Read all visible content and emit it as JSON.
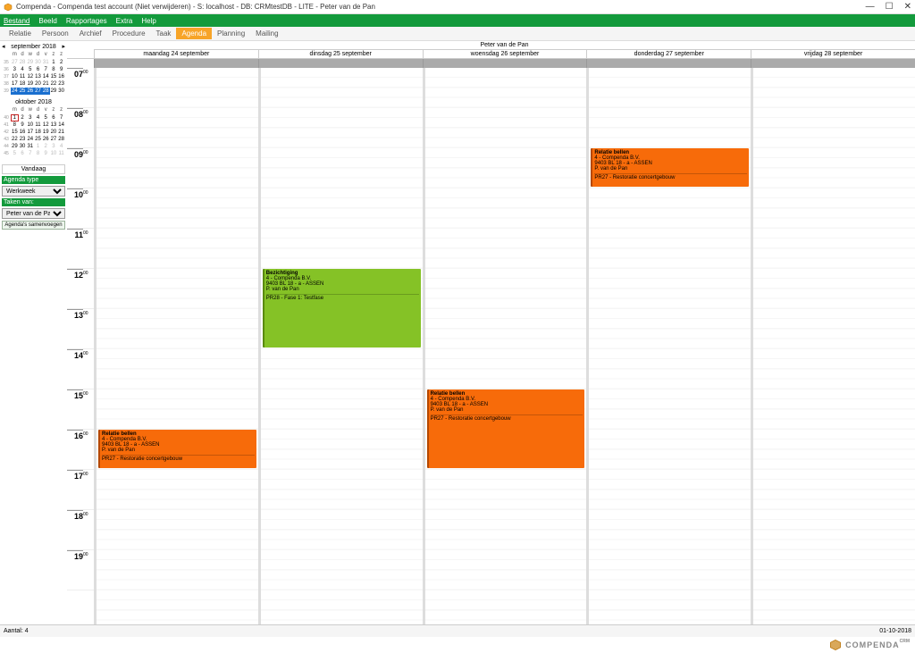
{
  "window": {
    "title": "Compenda - Compenda test account (Niet verwijderen) - S: localhost - DB: CRMtestDB - LITE - Peter van de Pan"
  },
  "menu": {
    "items": [
      "Bestand",
      "Beeld",
      "Rapportages",
      "Extra",
      "Help"
    ]
  },
  "tabs": {
    "items": [
      "Relatie",
      "Persoon",
      "Archief",
      "Procedure",
      "Taak",
      "Agenda",
      "Planning",
      "Mailing"
    ],
    "active": 5
  },
  "sidebar": {
    "month1": {
      "label": "september 2018",
      "dayheads": [
        "m",
        "d",
        "w",
        "d",
        "v",
        "z",
        "z"
      ],
      "rows": [
        {
          "wk": "35",
          "days": [
            "27",
            "28",
            "29",
            "30",
            "31",
            "1",
            "2"
          ],
          "dim": [
            0,
            1,
            2,
            3,
            4
          ]
        },
        {
          "wk": "36",
          "days": [
            "3",
            "4",
            "5",
            "6",
            "7",
            "8",
            "9"
          ],
          "dim": []
        },
        {
          "wk": "37",
          "days": [
            "10",
            "11",
            "12",
            "13",
            "14",
            "15",
            "16"
          ],
          "dim": []
        },
        {
          "wk": "38",
          "days": [
            "17",
            "18",
            "19",
            "20",
            "21",
            "22",
            "23"
          ],
          "dim": []
        },
        {
          "wk": "39",
          "days": [
            "24",
            "25",
            "26",
            "27",
            "28",
            "29",
            "30"
          ],
          "dim": [],
          "hl": [
            0,
            1,
            2,
            3,
            4
          ]
        }
      ]
    },
    "month2": {
      "label": "oktober 2018",
      "dayheads": [
        "m",
        "d",
        "w",
        "d",
        "v",
        "z",
        "z"
      ],
      "rows": [
        {
          "wk": "40",
          "days": [
            "1",
            "2",
            "3",
            "4",
            "5",
            "6",
            "7"
          ],
          "dim": [],
          "today": 0
        },
        {
          "wk": "41",
          "days": [
            "8",
            "9",
            "10",
            "11",
            "12",
            "13",
            "14"
          ],
          "dim": []
        },
        {
          "wk": "42",
          "days": [
            "15",
            "16",
            "17",
            "18",
            "19",
            "20",
            "21"
          ],
          "dim": []
        },
        {
          "wk": "43",
          "days": [
            "22",
            "23",
            "24",
            "25",
            "26",
            "27",
            "28"
          ],
          "dim": []
        },
        {
          "wk": "44",
          "days": [
            "29",
            "30",
            "31",
            "1",
            "2",
            "3",
            "4"
          ],
          "dim": [
            3,
            4,
            5,
            6
          ]
        },
        {
          "wk": "45",
          "days": [
            "5",
            "6",
            "7",
            "8",
            "9",
            "10",
            "11"
          ],
          "dim": [
            0,
            1,
            2,
            3,
            4,
            5,
            6
          ]
        }
      ]
    },
    "today_btn": "Vandaag",
    "agendatype_lbl": "Agenda type",
    "agendatype_val": "Werkweek",
    "taken_lbl": "Taken van:",
    "taken_val": "Peter van de Pan",
    "merge_btn": "Agenda's samenvoegen"
  },
  "agenda": {
    "person": "Peter van de Pan",
    "days": [
      "maandag 24 september",
      "dinsdag 25 september",
      "woensdag 26 september",
      "donderdag 27 september",
      "vrijdag 28 september"
    ],
    "hours": [
      "07",
      "08",
      "09",
      "10",
      "11",
      "12",
      "13",
      "14",
      "15",
      "16",
      "17",
      "18",
      "19"
    ],
    "minute_label": "00",
    "events": [
      {
        "day": 0,
        "start": 16,
        "dur": 1,
        "color": "orange",
        "title": "Relatie bellen",
        "l1": "4 - Compenda B.V.",
        "l2": "9403 BL 18 - a -  ASSEN",
        "l3": "P. van de Pan",
        "proj": "PR27 - Restoratie concertgebouw"
      },
      {
        "day": 1,
        "start": 12,
        "dur": 2,
        "color": "green",
        "title": "Bezichtiging",
        "l1": "4 - Compenda B.V.",
        "l2": "9403 BL 18 - a -  ASSEN",
        "l3": "P. van de Pan",
        "proj": "PR28 - Fase 1: Testfase"
      },
      {
        "day": 2,
        "start": 15,
        "dur": 2,
        "color": "orange",
        "title": "Relatie bellen",
        "l1": "4 - Compenda B.V.",
        "l2": "9403 BL 18 - a -  ASSEN",
        "l3": "P. van de Pan",
        "proj": "PR27 - Restoratie concertgebouw"
      },
      {
        "day": 3,
        "start": 9,
        "dur": 1,
        "color": "orange",
        "title": "Relatie bellen",
        "l1": "4 - Compenda B.V.",
        "l2": "9403 BL 18 - a -  ASSEN",
        "l3": "P. van de Pan",
        "proj": "PR27 - Restoratie concertgebouw"
      }
    ]
  },
  "statusbar": {
    "count": "Aantal: 4",
    "date": "01-10-2018"
  },
  "footer": {
    "brand": "COMPENDA",
    "sub": "CRM"
  }
}
